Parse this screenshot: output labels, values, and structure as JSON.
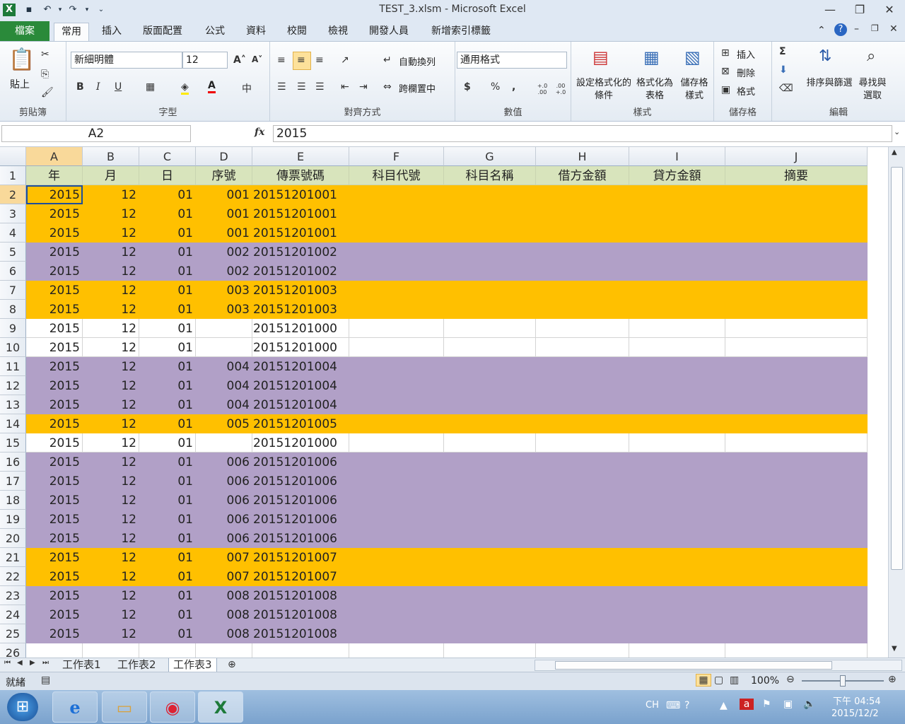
{
  "window": {
    "title": "TEST_3.xlsm  -  Microsoft Excel"
  },
  "ribbon_tabs": [
    "檔案",
    "常用",
    "插入",
    "版面配置",
    "公式",
    "資料",
    "校閱",
    "檢視",
    "開發人員",
    "新增索引標籤"
  ],
  "clipboard": {
    "paste": "貼上",
    "label": "剪貼簿"
  },
  "font": {
    "name": "新細明體",
    "size": "12",
    "bold": "B",
    "italic": "I",
    "underline": "U",
    "label": "字型"
  },
  "alignment": {
    "wrap": "自動換列",
    "merge": "跨欄置中",
    "label": "對齊方式"
  },
  "number": {
    "format": "通用格式",
    "currency": "$",
    "percent": "%",
    "comma": ",",
    "inc_dec": "+.0 .00",
    "dec_dec": ".00 +.0",
    "label": "數值"
  },
  "styles": {
    "cond": "設定格式化的條件",
    "table": "格式化為表格",
    "cell": "儲存格樣式",
    "label": "樣式"
  },
  "cells": {
    "insert": "插入",
    "delete": "刪除",
    "format": "格式",
    "label": "儲存格"
  },
  "editing": {
    "sum": "Σ",
    "sort": "排序與篩選",
    "find": "尋找與選取",
    "label": "編輯"
  },
  "formula_bar": {
    "name_box": "A2",
    "fx": "fx",
    "value": "2015"
  },
  "columns": [
    "A",
    "B",
    "C",
    "D",
    "E",
    "F",
    "G",
    "H",
    "I",
    "J"
  ],
  "header_row": [
    "年",
    "月",
    "日",
    "序號",
    "傳票號碼",
    "科目代號",
    "科目名稱",
    "借方金額",
    "貸方金額",
    "摘要"
  ],
  "rows": [
    {
      "n": "2",
      "c": "orange",
      "v": [
        "2015",
        "12",
        "01",
        "001",
        "20151201001"
      ]
    },
    {
      "n": "3",
      "c": "orange",
      "v": [
        "2015",
        "12",
        "01",
        "001",
        "20151201001"
      ]
    },
    {
      "n": "4",
      "c": "orange",
      "v": [
        "2015",
        "12",
        "01",
        "001",
        "20151201001"
      ]
    },
    {
      "n": "5",
      "c": "purple",
      "v": [
        "2015",
        "12",
        "01",
        "002",
        "20151201002"
      ]
    },
    {
      "n": "6",
      "c": "purple",
      "v": [
        "2015",
        "12",
        "01",
        "002",
        "20151201002"
      ]
    },
    {
      "n": "7",
      "c": "orange",
      "v": [
        "2015",
        "12",
        "01",
        "003",
        "20151201003"
      ]
    },
    {
      "n": "8",
      "c": "orange",
      "v": [
        "2015",
        "12",
        "01",
        "003",
        "20151201003"
      ]
    },
    {
      "n": "9",
      "c": "white",
      "v": [
        "2015",
        "12",
        "01",
        "",
        "20151201000"
      ]
    },
    {
      "n": "10",
      "c": "white",
      "v": [
        "2015",
        "12",
        "01",
        "",
        "20151201000"
      ]
    },
    {
      "n": "11",
      "c": "purple",
      "v": [
        "2015",
        "12",
        "01",
        "004",
        "20151201004"
      ]
    },
    {
      "n": "12",
      "c": "purple",
      "v": [
        "2015",
        "12",
        "01",
        "004",
        "20151201004"
      ]
    },
    {
      "n": "13",
      "c": "purple",
      "v": [
        "2015",
        "12",
        "01",
        "004",
        "20151201004"
      ]
    },
    {
      "n": "14",
      "c": "orange",
      "v": [
        "2015",
        "12",
        "01",
        "005",
        "20151201005"
      ]
    },
    {
      "n": "15",
      "c": "white",
      "v": [
        "2015",
        "12",
        "01",
        "",
        "20151201000"
      ]
    },
    {
      "n": "16",
      "c": "purple",
      "v": [
        "2015",
        "12",
        "01",
        "006",
        "20151201006"
      ]
    },
    {
      "n": "17",
      "c": "purple",
      "v": [
        "2015",
        "12",
        "01",
        "006",
        "20151201006"
      ]
    },
    {
      "n": "18",
      "c": "purple",
      "v": [
        "2015",
        "12",
        "01",
        "006",
        "20151201006"
      ]
    },
    {
      "n": "19",
      "c": "purple",
      "v": [
        "2015",
        "12",
        "01",
        "006",
        "20151201006"
      ]
    },
    {
      "n": "20",
      "c": "purple",
      "v": [
        "2015",
        "12",
        "01",
        "006",
        "20151201006"
      ]
    },
    {
      "n": "21",
      "c": "orange",
      "v": [
        "2015",
        "12",
        "01",
        "007",
        "20151201007"
      ]
    },
    {
      "n": "22",
      "c": "orange",
      "v": [
        "2015",
        "12",
        "01",
        "007",
        "20151201007"
      ]
    },
    {
      "n": "23",
      "c": "purple",
      "v": [
        "2015",
        "12",
        "01",
        "008",
        "20151201008"
      ]
    },
    {
      "n": "24",
      "c": "purple",
      "v": [
        "2015",
        "12",
        "01",
        "008",
        "20151201008"
      ]
    },
    {
      "n": "25",
      "c": "purple",
      "v": [
        "2015",
        "12",
        "01",
        "008",
        "20151201008"
      ]
    },
    {
      "n": "26",
      "c": "white",
      "v": [
        "",
        "",
        "",
        "",
        ""
      ]
    }
  ],
  "colors": {
    "orange": "#ffc000",
    "purple": "#b1a0c7",
    "header": "#d8e4bc",
    "white": "#ffffff"
  },
  "sheets": [
    "工作表1",
    "工作表2",
    "工作表3"
  ],
  "status": {
    "ready": "就緒",
    "zoom": "100%"
  },
  "taskbar": {
    "lang": "CH",
    "time": "下午 04:54",
    "date": "2015/12/2"
  }
}
